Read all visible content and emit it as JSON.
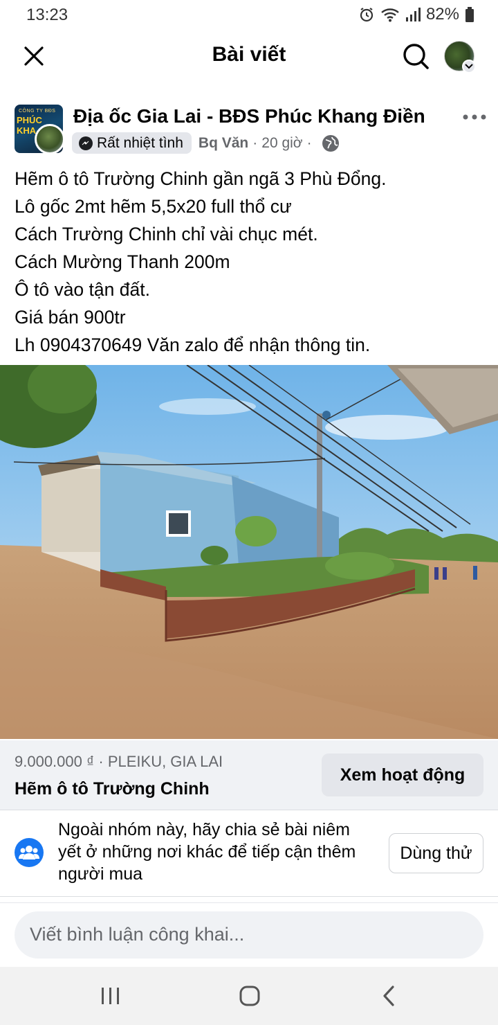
{
  "status_bar": {
    "time": "13:23",
    "battery": "82%",
    "icons": [
      "alarm-icon",
      "wifi-icon",
      "signal-icon",
      "battery-icon"
    ]
  },
  "header": {
    "title": "Bài viết",
    "icons": [
      "close-icon",
      "search-icon"
    ]
  },
  "post": {
    "group_name": "Địa ốc Gia Lai - BĐS Phúc Khang Điền",
    "group_avatar_text": {
      "line1": "CÔNG TY BĐS",
      "line2": "PHÚC KHA"
    },
    "badge": "Rất nhiệt tình",
    "author": "Bq Văn",
    "separator": "·",
    "time": "20 giờ",
    "privacy_icon": "globe-icon",
    "lines": [
      "Hẽm ô tô Trường Chinh gần ngã 3 Phù Đổng.",
      "Lô gốc 2mt hẽm 5,5x20 full thổ cư",
      "Cách Trường Chinh chỉ vài chục mét.",
      "Cách Mường Thanh 200m",
      "Ô tô vào tận đất.",
      "Giá bán 900tr",
      "Lh 0904370649 Văn zalo để nhận thông tin."
    ]
  },
  "listing": {
    "price_location": "9.000.000 ₫ · PLEIKU, GIA LAI",
    "title": "Hẽm ô tô Trường Chinh",
    "activity_button": "Xem hoạt động"
  },
  "share": {
    "text": "Ngoài nhóm này, hãy chia sẻ bài niêm yết ở những nơi khác để tiếp cận thêm người mua",
    "try_button": "Dùng thử"
  },
  "comment": {
    "placeholder": "Viết bình luận công khai..."
  },
  "colors": {
    "accent": "#1877f2",
    "secondary_text": "#65676b",
    "listing_bg": "#f0f2f5"
  }
}
